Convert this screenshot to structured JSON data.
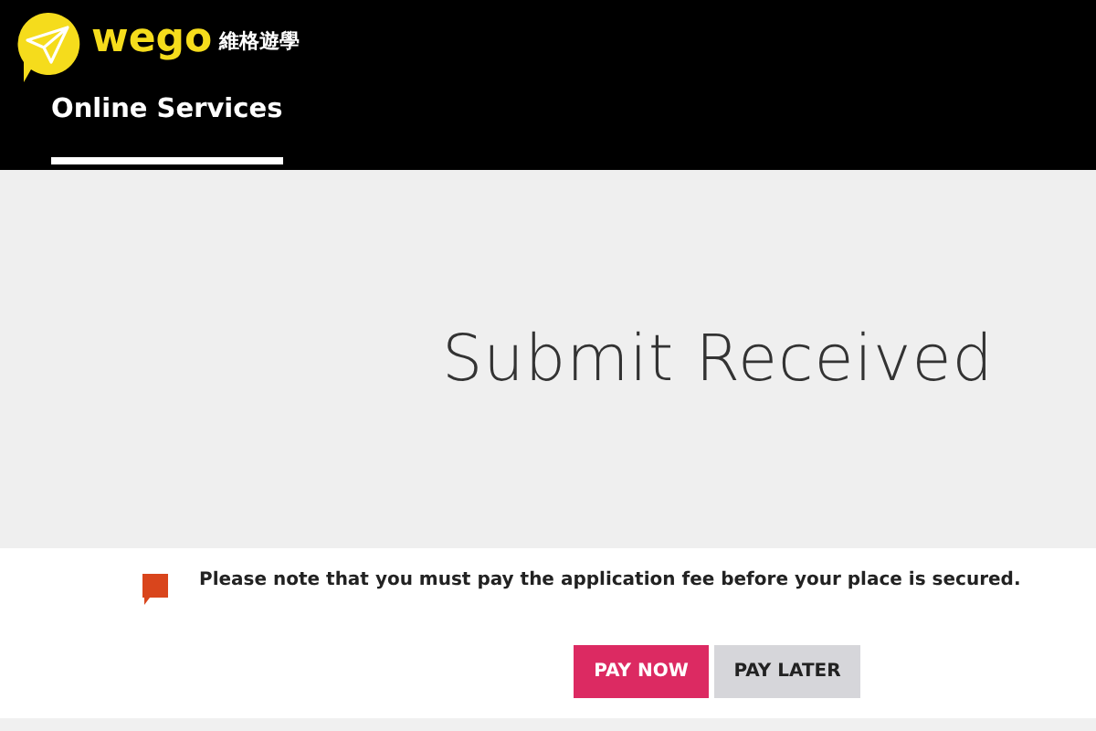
{
  "header": {
    "brand": "wego",
    "brand_subtitle": "維格遊學",
    "tabs": [
      {
        "label": "Online Services",
        "selected": true
      }
    ]
  },
  "banner": {
    "title": "Submit Received"
  },
  "notice": {
    "text": "Please note that you must pay the application fee before your place is secured."
  },
  "buttons": [
    {
      "label": "PAY NOW",
      "kind": "primary"
    },
    {
      "label": "PAY LATER",
      "kind": "secondary"
    }
  ]
}
